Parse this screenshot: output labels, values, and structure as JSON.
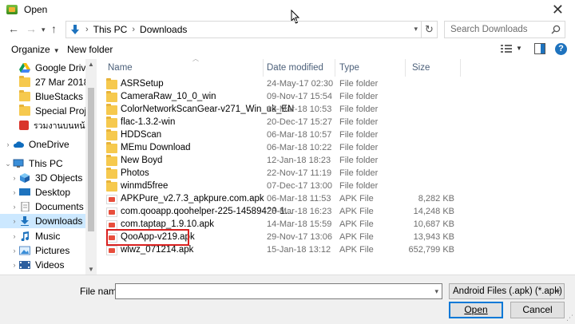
{
  "window": {
    "title": "Open"
  },
  "navigation": {
    "breadcrumb": [
      "This PC",
      "Downloads"
    ],
    "search_placeholder": "Search Downloads"
  },
  "toolbar": {
    "organize_label": "Organize",
    "new_folder_label": "New folder"
  },
  "sidebar": {
    "items": [
      {
        "label": "Google Drive",
        "icon": "google-drive-icon",
        "pinned": true
      },
      {
        "label": "27 Mar 2018",
        "icon": "folder-icon"
      },
      {
        "label": "BlueStacks",
        "icon": "folder-icon"
      },
      {
        "label": "Special Project",
        "icon": "folder-icon"
      },
      {
        "label": "รวมงานบนหน้าจอ",
        "icon": "app-icon"
      },
      {
        "label": "OneDrive",
        "icon": "cloud-icon"
      },
      {
        "label": "This PC",
        "icon": "computer-icon"
      },
      {
        "label": "3D Objects",
        "icon": "cube-icon"
      },
      {
        "label": "Desktop",
        "icon": "desktop-icon"
      },
      {
        "label": "Documents",
        "icon": "documents-icon"
      },
      {
        "label": "Downloads",
        "icon": "downloads-icon",
        "selected": true
      },
      {
        "label": "Music",
        "icon": "music-icon"
      },
      {
        "label": "Pictures",
        "icon": "pictures-icon"
      },
      {
        "label": "Videos",
        "icon": "videos-icon"
      }
    ]
  },
  "filelist": {
    "columns": [
      "Name",
      "Date modified",
      "Type",
      "Size"
    ],
    "rows": [
      {
        "name": "ASRSetup",
        "date": "24-May-17 02:30",
        "type": "File folder",
        "size": "",
        "kind": "folder"
      },
      {
        "name": "CameraRaw_10_0_win",
        "date": "09-Nov-17 15:54",
        "type": "File folder",
        "size": "",
        "kind": "folder"
      },
      {
        "name": "ColorNetworkScanGear-v271_Win_uk_EN",
        "date": "15-Mar-18 10:53",
        "type": "File folder",
        "size": "",
        "kind": "folder"
      },
      {
        "name": "flac-1.3.2-win",
        "date": "20-Dec-17 15:27",
        "type": "File folder",
        "size": "",
        "kind": "folder"
      },
      {
        "name": "HDDScan",
        "date": "06-Mar-18 10:57",
        "type": "File folder",
        "size": "",
        "kind": "folder"
      },
      {
        "name": "MEmu Download",
        "date": "06-Mar-18 10:22",
        "type": "File folder",
        "size": "",
        "kind": "folder"
      },
      {
        "name": "New Boyd",
        "date": "12-Jan-18 18:23",
        "type": "File folder",
        "size": "",
        "kind": "folder"
      },
      {
        "name": "Photos",
        "date": "22-Nov-17 11:19",
        "type": "File folder",
        "size": "",
        "kind": "folder"
      },
      {
        "name": "winmd5free",
        "date": "07-Dec-17 13:00",
        "type": "File folder",
        "size": "",
        "kind": "folder"
      },
      {
        "name": "APKPure_v2.7.3_apkpure.com.apk",
        "date": "06-Mar-18 11:53",
        "type": "APK File",
        "size": "8,282 KB",
        "kind": "apk"
      },
      {
        "name": "com.qooapp.qoohelper-225-14589420-1...",
        "date": "28-Mar-18 16:23",
        "type": "APK File",
        "size": "14,248 KB",
        "kind": "apk"
      },
      {
        "name": "com.taptap_1.9.10.apk",
        "date": "14-Mar-18 15:59",
        "type": "APK File",
        "size": "10,687 KB",
        "kind": "apk"
      },
      {
        "name": "QooApp-v219.apk",
        "date": "29-Nov-17 13:06",
        "type": "APK File",
        "size": "13,943 KB",
        "kind": "apk"
      },
      {
        "name": "wlwz_071214.apk",
        "date": "15-Jan-18 13:12",
        "type": "APK File",
        "size": "652,799 KB",
        "kind": "apk"
      }
    ]
  },
  "bottom": {
    "file_name_label": "File name:",
    "file_name_value": "",
    "filter_value": "Android Files (.apk) (*.apk)",
    "open_label": "Open",
    "cancel_label": "Cancel"
  }
}
